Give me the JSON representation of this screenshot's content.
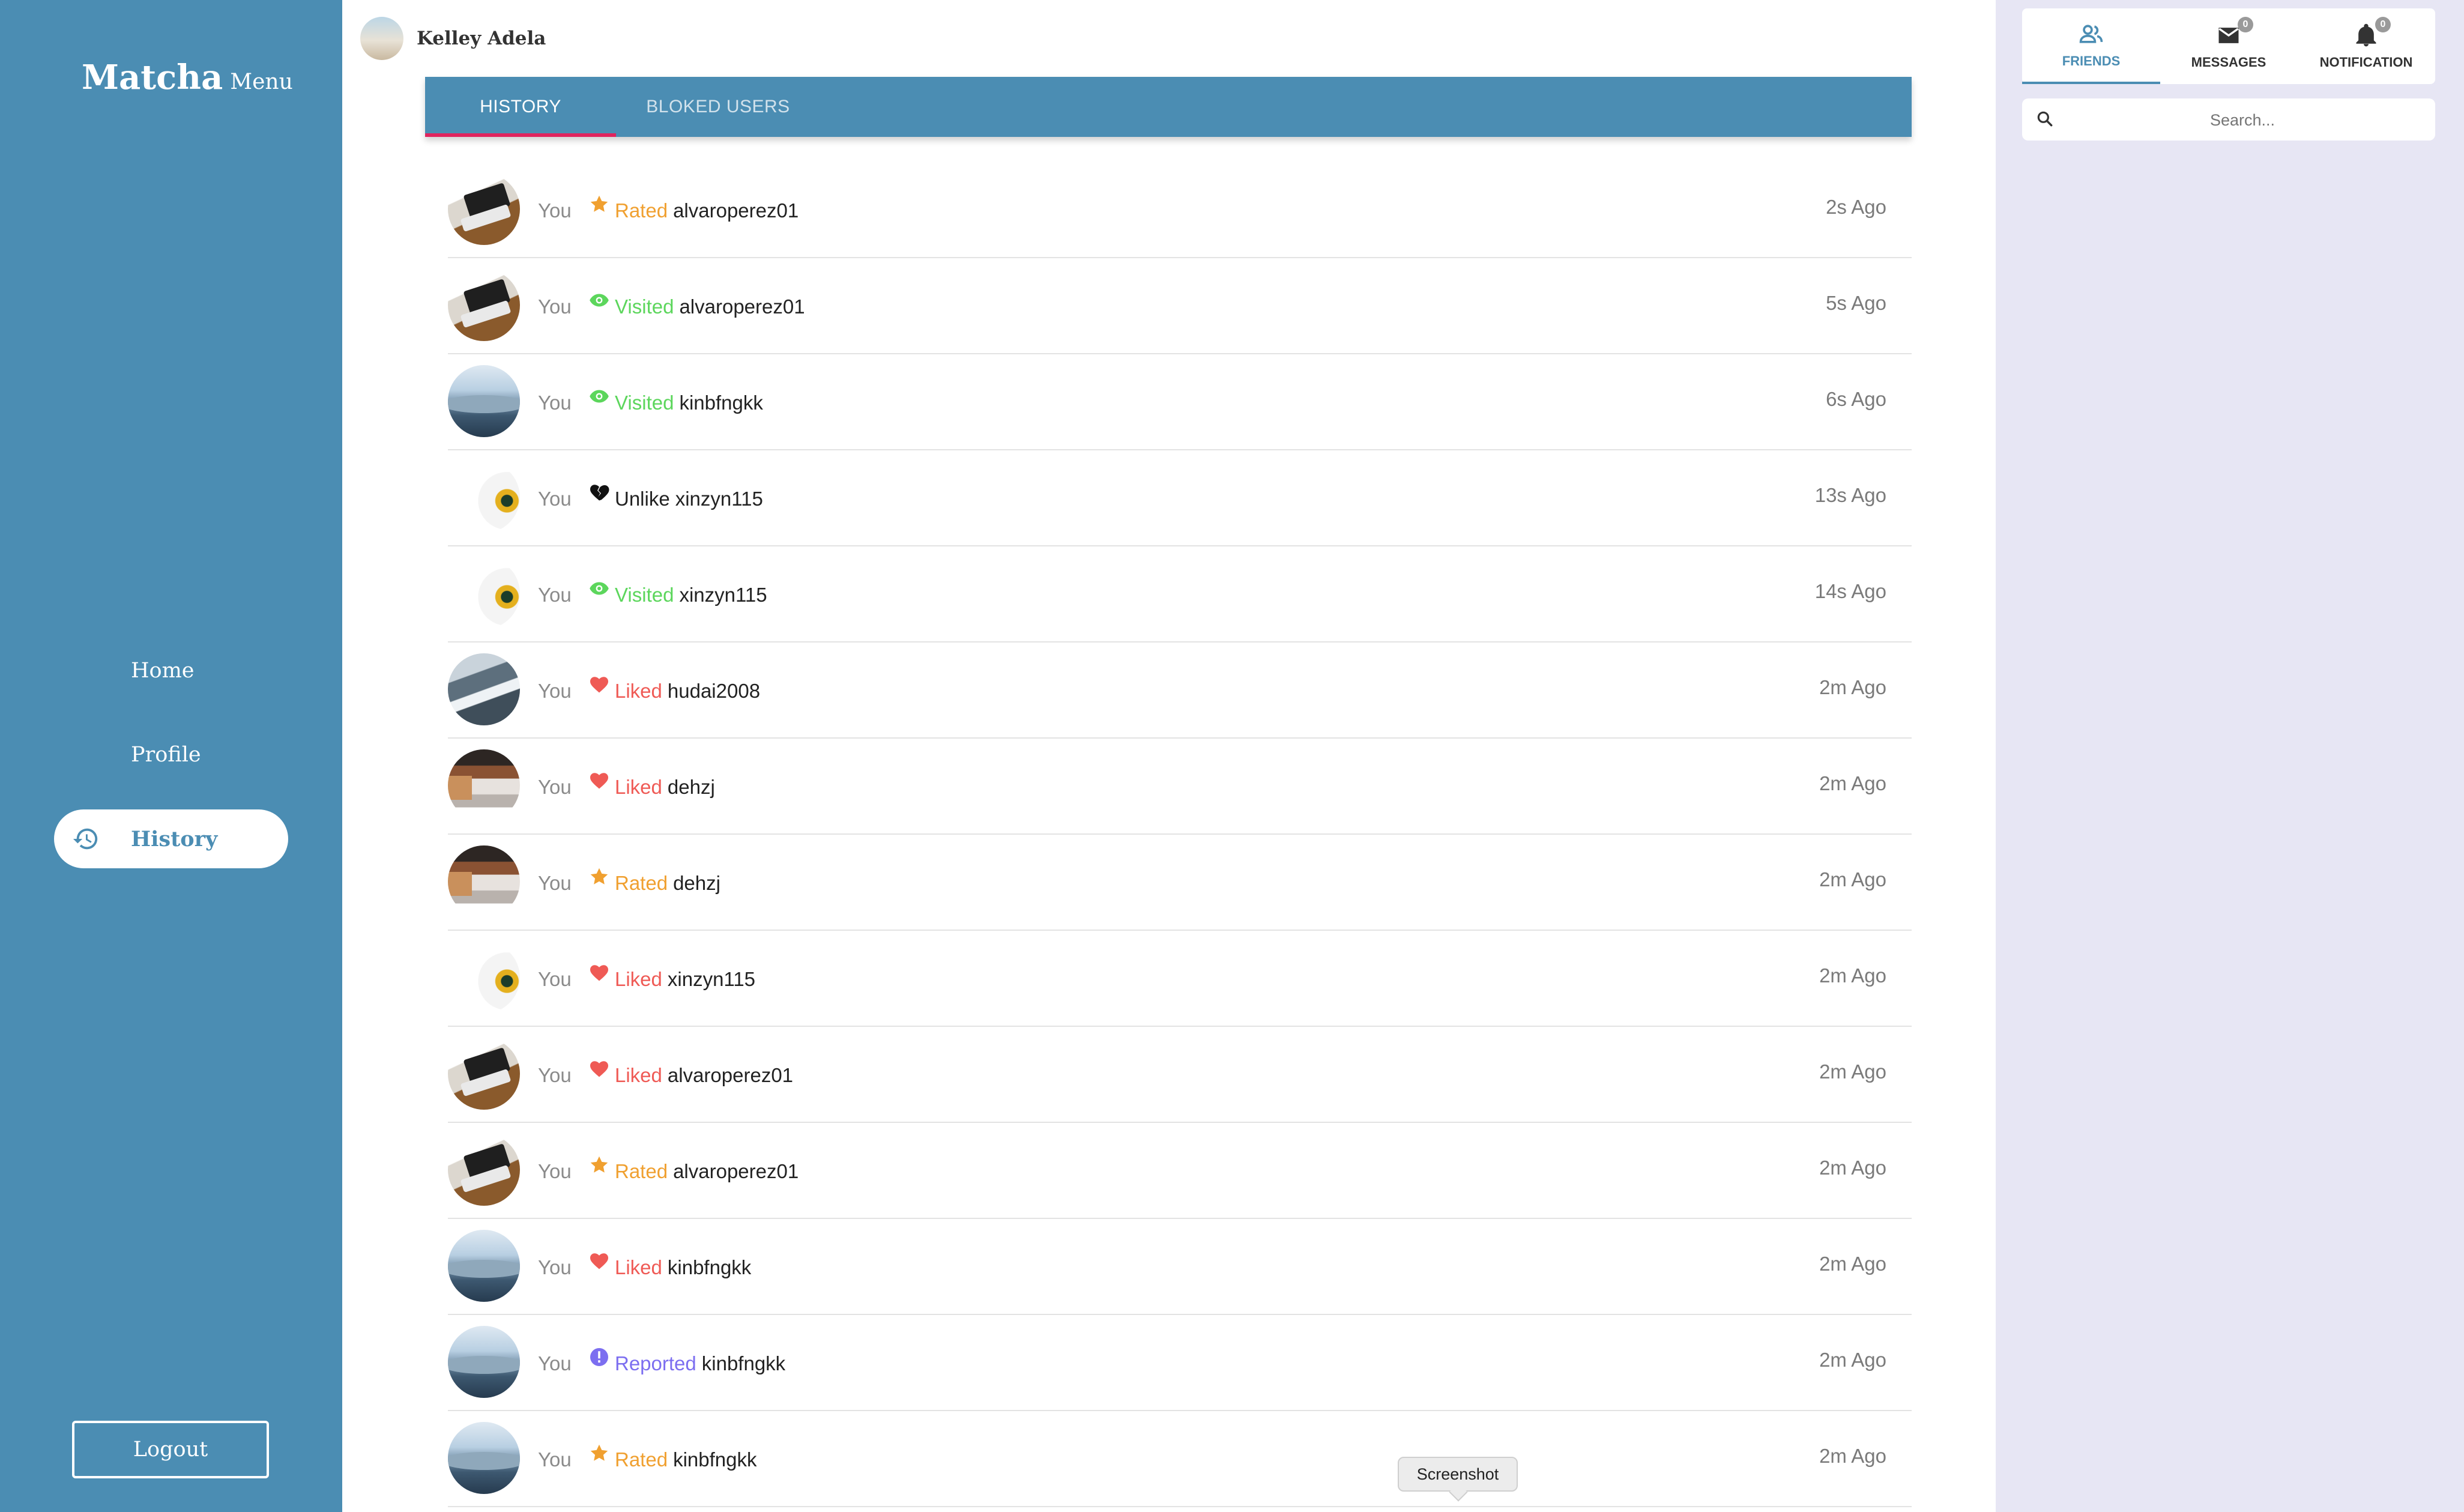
{
  "sidebar": {
    "brand": "Matcha",
    "brand_sub": "Menu",
    "items": [
      {
        "label": "Home"
      },
      {
        "label": "Profile"
      },
      {
        "label": "History"
      }
    ],
    "logout_label": "Logout",
    "accent_color": "#4b8db3"
  },
  "header": {
    "user_name": "Kelley Adela"
  },
  "tabs": [
    {
      "label": "HISTORY"
    },
    {
      "label": "BLOKED USERS"
    }
  ],
  "history": [
    {
      "actor": "You",
      "action": "Rated",
      "target": "alvaroperez01",
      "time": "2s Ago",
      "icon": "star-icon",
      "avatar": "laptop"
    },
    {
      "actor": "You",
      "action": "Visited",
      "target": "alvaroperez01",
      "time": "5s Ago",
      "icon": "eye-icon",
      "avatar": "laptop"
    },
    {
      "actor": "You",
      "action": "Visited",
      "target": "kinbfngkk",
      "time": "6s Ago",
      "icon": "eye-icon",
      "avatar": "lake"
    },
    {
      "actor": "You",
      "action": "Unlike",
      "target": "xinzyn115",
      "time": "13s Ago",
      "icon": "broken-heart-icon",
      "avatar": "flower"
    },
    {
      "actor": "You",
      "action": "Visited",
      "target": "xinzyn115",
      "time": "14s Ago",
      "icon": "eye-icon",
      "avatar": "flower"
    },
    {
      "actor": "You",
      "action": "Liked",
      "target": "hudai2008",
      "time": "2m Ago",
      "icon": "heart-icon",
      "avatar": "mountain"
    },
    {
      "actor": "You",
      "action": "Liked",
      "target": "dehzj",
      "time": "2m Ago",
      "icon": "heart-icon",
      "avatar": "collage"
    },
    {
      "actor": "You",
      "action": "Rated",
      "target": "dehzj",
      "time": "2m Ago",
      "icon": "star-icon",
      "avatar": "collage"
    },
    {
      "actor": "You",
      "action": "Liked",
      "target": "xinzyn115",
      "time": "2m Ago",
      "icon": "heart-icon",
      "avatar": "flower"
    },
    {
      "actor": "You",
      "action": "Liked",
      "target": "alvaroperez01",
      "time": "2m Ago",
      "icon": "heart-icon",
      "avatar": "laptop"
    },
    {
      "actor": "You",
      "action": "Rated",
      "target": "alvaroperez01",
      "time": "2m Ago",
      "icon": "star-icon",
      "avatar": "laptop"
    },
    {
      "actor": "You",
      "action": "Liked",
      "target": "kinbfngkk",
      "time": "2m Ago",
      "icon": "heart-icon",
      "avatar": "lake"
    },
    {
      "actor": "You",
      "action": "Reported",
      "target": "kinbfngkk",
      "time": "2m Ago",
      "icon": "alert-icon",
      "avatar": "lake"
    },
    {
      "actor": "You",
      "action": "Rated",
      "target": "kinbfngkk",
      "time": "2m Ago",
      "icon": "star-icon",
      "avatar": "lake"
    }
  ],
  "right_panel": {
    "tabs": [
      {
        "label": "FRIENDS",
        "icon": "friends-icon"
      },
      {
        "label": "MESSAGES",
        "icon": "mail-icon",
        "badge": "0"
      },
      {
        "label": "NOTIFICATION",
        "icon": "bell-icon",
        "badge": "0"
      }
    ],
    "search_placeholder": "Search..."
  },
  "tooltip": "Screenshot",
  "colors": {
    "rated": "#f0a030",
    "visited": "#5cd65c",
    "liked": "#ef5a55",
    "unlike": "#222222",
    "reported": "#7c6ef0",
    "tab_indicator": "#e0245e",
    "panel_bg": "#e7e6f4"
  }
}
